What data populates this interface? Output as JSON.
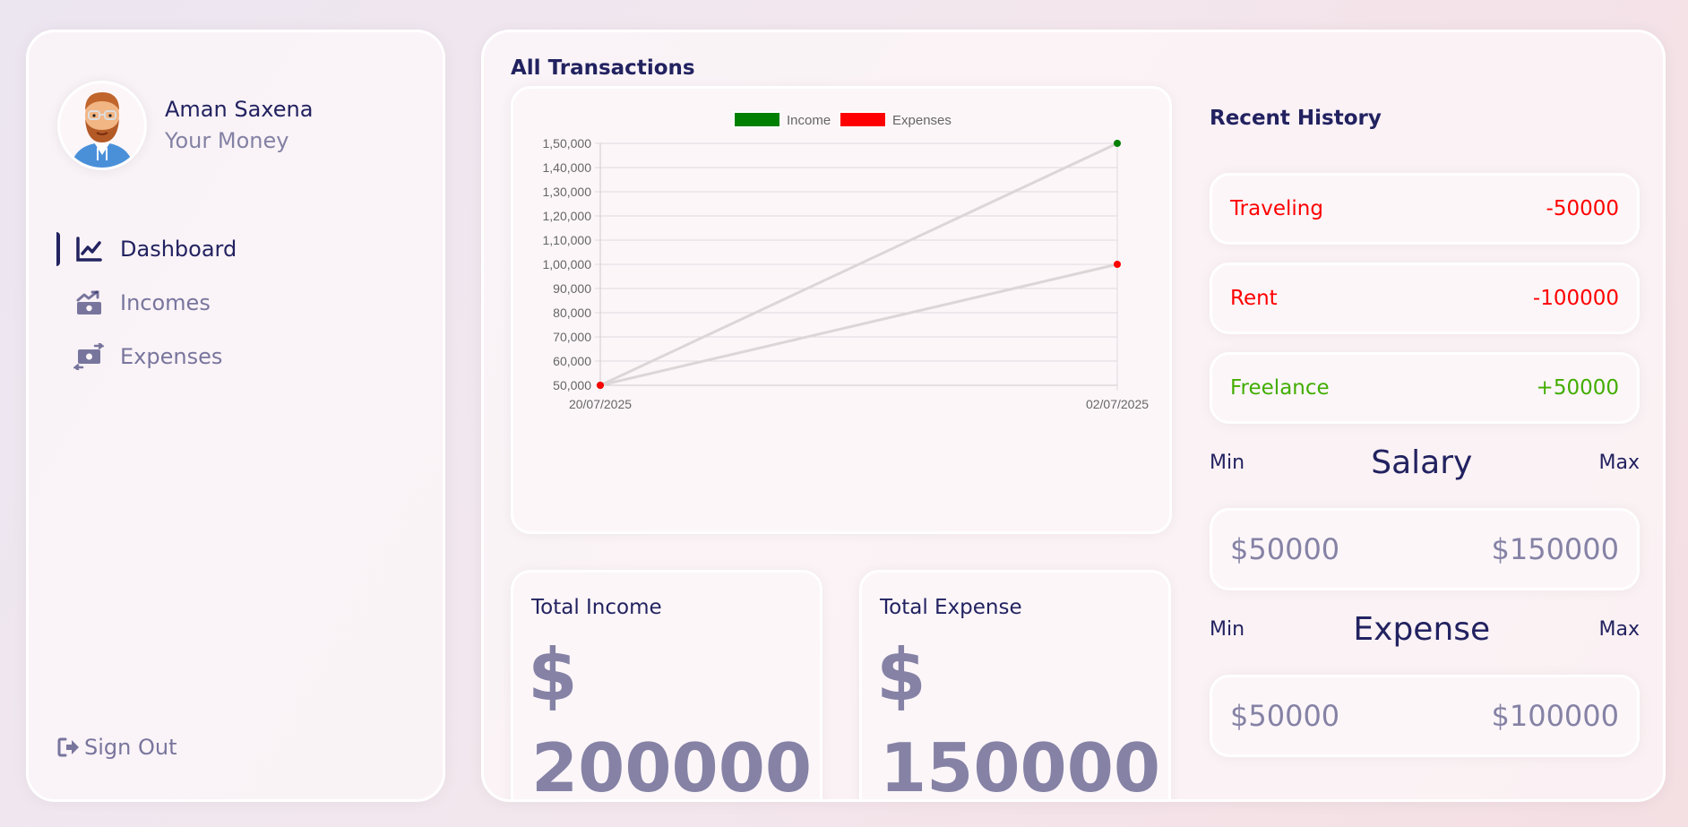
{
  "user": {
    "name": "Aman Saxena",
    "subtitle": "Your Money"
  },
  "menu": [
    {
      "label": "Dashboard",
      "icon": "chart-line-icon",
      "active": true
    },
    {
      "label": "Incomes",
      "icon": "money-trend-icon",
      "active": false
    },
    {
      "label": "Expenses",
      "icon": "money-exchange-icon",
      "active": false
    }
  ],
  "signout": {
    "label": "Sign Out",
    "icon": "sign-out-icon"
  },
  "main": {
    "title": "All Transactions"
  },
  "chart_data": {
    "type": "line",
    "x": [
      "20/07/2025",
      "02/07/2025"
    ],
    "series": [
      {
        "name": "Income",
        "values": [
          50000,
          150000
        ],
        "color": "#008000"
      },
      {
        "name": "Expenses",
        "values": [
          50000,
          100000
        ],
        "color": "#ff0000"
      }
    ],
    "yticks": [
      "50,000",
      "60,000",
      "70,000",
      "80,000",
      "90,000",
      "1,00,000",
      "1,10,000",
      "1,20,000",
      "1,30,000",
      "1,40,000",
      "1,50,000"
    ],
    "ylim": [
      50000,
      150000
    ],
    "grid": true,
    "legend": "top",
    "line_color": "#dcd6d8"
  },
  "totals": {
    "income": {
      "title": "Total Income",
      "currency": "$",
      "value": "200000"
    },
    "expense": {
      "title": "Total Expense",
      "currency": "$",
      "value": "150000"
    }
  },
  "history": {
    "title": "Recent History",
    "items": [
      {
        "label": "Traveling",
        "amount": "-50000",
        "color": "#ff0000"
      },
      {
        "label": "Rent",
        "amount": "-100000",
        "color": "#ff0000"
      },
      {
        "label": "Freelance",
        "amount": "+50000",
        "color": "#42ad00"
      }
    ]
  },
  "salary": {
    "min_label": "Min",
    "title": "Salary",
    "max_label": "Max",
    "min": "$50000",
    "max": "$150000"
  },
  "expense_range": {
    "min_label": "Min",
    "title": "Expense",
    "max_label": "Max",
    "min": "$50000",
    "max": "$100000"
  }
}
